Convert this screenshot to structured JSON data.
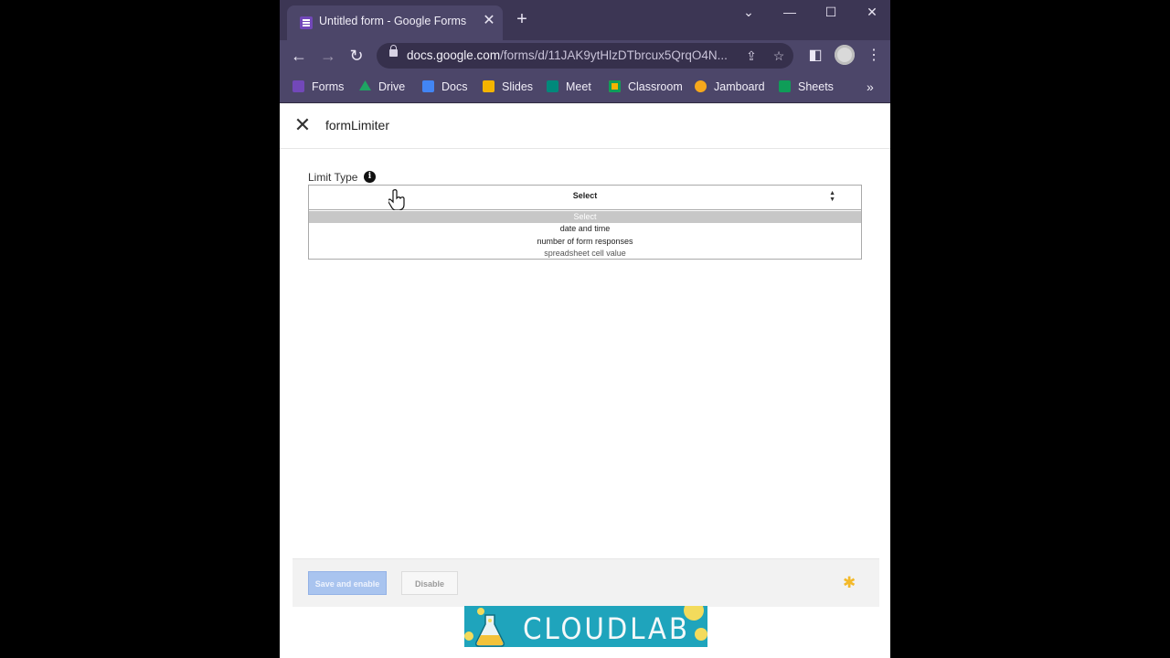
{
  "browser": {
    "tab_title": "Untitled form - Google Forms",
    "tab_close": "✕",
    "new_tab": "+",
    "window_controls": {
      "dropdown": "⌄",
      "minimize": "—",
      "maximize": "☐",
      "close": "✕"
    },
    "url_host": "docs.google.com",
    "url_path": "/forms/d/11JAK9ytHlzDTbrcux5QrqO4N...",
    "nav": {
      "back": "←",
      "forward": "→",
      "reload": "↻"
    },
    "bookmarks": [
      {
        "label": "Forms",
        "color": "#7248b9"
      },
      {
        "label": "Drive",
        "color": "#1fa463"
      },
      {
        "label": "Docs",
        "color": "#4285f4"
      },
      {
        "label": "Slides",
        "color": "#f4b400"
      },
      {
        "label": "Meet",
        "color": "#00897b"
      },
      {
        "label": "Classroom",
        "color": "#f4b400"
      },
      {
        "label": "Jamboard",
        "color": "#f6a81c"
      },
      {
        "label": "Sheets",
        "color": "#0f9d58"
      }
    ],
    "bookmarks_more": "»"
  },
  "panel": {
    "close": "✕",
    "title": "formLimiter",
    "field_label": "Limit Type",
    "info": "i",
    "select": {
      "value": "Select",
      "options": [
        "Select",
        "date and time",
        "number of form responses",
        "spreadsheet cell value"
      ],
      "selected_index": 0
    },
    "save_button": "Save and enable",
    "disable_button": "Disable"
  },
  "banner": {
    "text": "CLOUDLAB"
  },
  "colors": {
    "accent": "#6c9be0",
    "save": "#a9c4ef",
    "chrome": "#4c4669",
    "banner": "#1fa4bc"
  }
}
